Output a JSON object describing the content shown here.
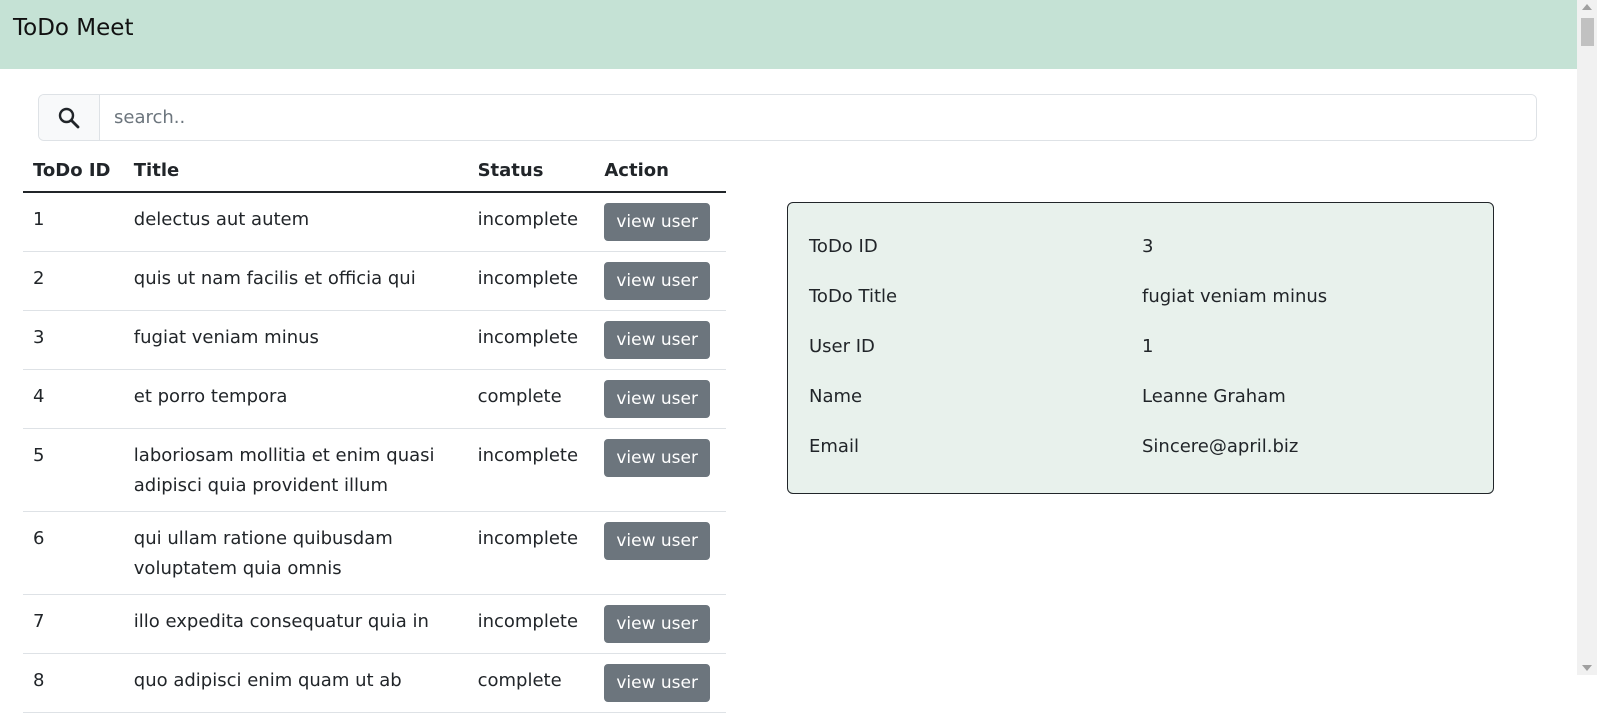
{
  "navbar": {
    "brand": "ToDo Meet"
  },
  "search": {
    "placeholder": "search..",
    "value": ""
  },
  "table": {
    "headers": [
      "ToDo ID",
      "Title",
      "Status",
      "Action"
    ],
    "action_label": "view user",
    "rows": [
      {
        "id": "1",
        "title": "delectus aut autem",
        "status": "incomplete"
      },
      {
        "id": "2",
        "title": "quis ut nam facilis et officia qui",
        "status": "incomplete"
      },
      {
        "id": "3",
        "title": "fugiat veniam minus",
        "status": "incomplete"
      },
      {
        "id": "4",
        "title": "et porro tempora",
        "status": "complete"
      },
      {
        "id": "5",
        "title": "laboriosam mollitia et enim quasi adipisci quia provident illum",
        "status": "incomplete"
      },
      {
        "id": "6",
        "title": "qui ullam ratione quibusdam voluptatem quia omnis",
        "status": "incomplete"
      },
      {
        "id": "7",
        "title": "illo expedita consequatur quia in",
        "status": "incomplete"
      },
      {
        "id": "8",
        "title": "quo adipisci enim quam ut ab",
        "status": "complete"
      }
    ]
  },
  "detail": {
    "rows": [
      {
        "label": "ToDo ID",
        "value": "3"
      },
      {
        "label": "ToDo Title",
        "value": "fugiat veniam minus"
      },
      {
        "label": "User ID",
        "value": "1"
      },
      {
        "label": "Name",
        "value": "Leanne Graham"
      },
      {
        "label": "Email",
        "value": "Sincere@april.biz"
      }
    ]
  },
  "colors": {
    "navbar_bg": "#c5e2d5",
    "card_bg": "#e8f1ec",
    "button_bg": "#6c757d"
  },
  "icons": {
    "search": "search-icon"
  }
}
